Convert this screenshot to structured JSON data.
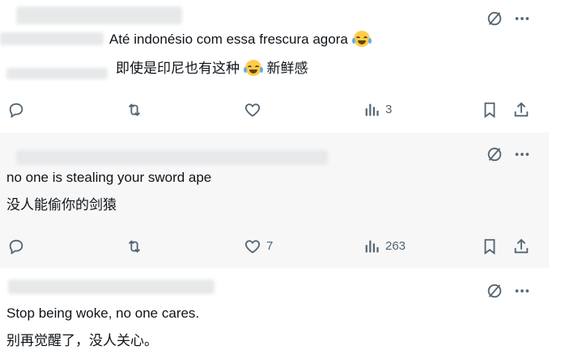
{
  "tweets": [
    {
      "text_original": "Até indonésio com essa frescura  agora",
      "text_translated_a": "即使是印尼也有这种",
      "text_translated_b": "新鲜感",
      "reply_count": "",
      "retweet_count": "",
      "like_count": "",
      "view_count": "3"
    },
    {
      "text_original": "no one is stealing your sword ape",
      "text_translated": "没人能偷你的剑猿",
      "reply_count": "",
      "retweet_count": "",
      "like_count": "7",
      "view_count": "263"
    },
    {
      "text_original": "Stop being woke, no one cares.",
      "text_translated": "别再觉醒了，没人关心。"
    }
  ],
  "icons": {
    "mute": "circle-slash-icon",
    "more": "more-dots-icon",
    "reply": "reply-icon",
    "retweet": "retweet-icon",
    "like": "heart-icon",
    "views": "views-bar-icon",
    "bookmark": "bookmark-icon",
    "share": "share-icon"
  },
  "colors": {
    "icon_gray": "#536471",
    "text": "#0f1419",
    "alt_background": "#f7f7f7"
  }
}
